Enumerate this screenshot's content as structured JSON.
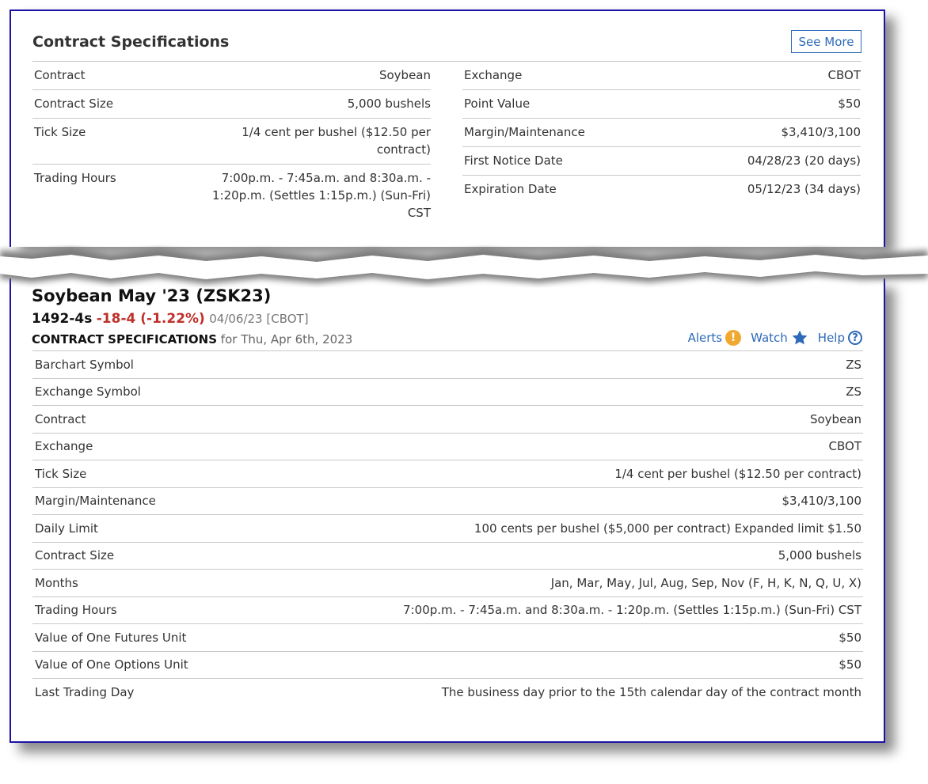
{
  "top": {
    "title": "Contract Specifications",
    "see_more_label": "See More",
    "left_rows": [
      {
        "label": "Contract",
        "value": "Soybean"
      },
      {
        "label": "Contract Size",
        "value": "5,000 bushels"
      },
      {
        "label": "Tick Size",
        "value": "1/4 cent per bushel ($12.50 per contract)"
      },
      {
        "label": "Trading Hours",
        "value": "7:00p.m. - 7:45a.m. and 8:30a.m. - 1:20p.m. (Settles 1:15p.m.) (Sun-Fri) CST"
      }
    ],
    "right_rows": [
      {
        "label": "Exchange",
        "value": "CBOT"
      },
      {
        "label": "Point Value",
        "value": "$50"
      },
      {
        "label": "Margin/Maintenance",
        "value": "$3,410/3,100"
      },
      {
        "label": "First Notice Date",
        "value": "04/28/23 (20 days)"
      },
      {
        "label": "Expiration Date",
        "value": "05/12/23 (34 days)"
      }
    ]
  },
  "quote": {
    "title": "Soybean May '23 (ZSK23)",
    "price": "1492-4s",
    "change": "-18-4 (-1.22%)",
    "date_exchange": "04/06/23 [CBOT]",
    "section_label": "CONTRACT SPECIFICATIONS",
    "section_date": "for Thu, Apr 6th, 2023",
    "alerts_label": "Alerts",
    "watch_label": "Watch",
    "help_label": "Help"
  },
  "contract_table": [
    {
      "label": "Barchart Symbol",
      "value": "ZS"
    },
    {
      "label": "Exchange Symbol",
      "value": "ZS"
    },
    {
      "label": "Contract",
      "value": "Soybean"
    },
    {
      "label": "Exchange",
      "value": "CBOT"
    },
    {
      "label": "Tick Size",
      "value": "1/4 cent per bushel ($12.50 per contract)"
    },
    {
      "label": "Margin/Maintenance",
      "value": "$3,410/3,100"
    },
    {
      "label": "Daily Limit",
      "value": "100 cents per bushel ($5,000 per contract) Expanded limit $1.50"
    },
    {
      "label": "Contract Size",
      "value": "5,000 bushels"
    },
    {
      "label": "Months",
      "value": "Jan, Mar, May, Jul, Aug, Sep, Nov (F, H, K, N, Q, U, X)"
    },
    {
      "label": "Trading Hours",
      "value": "7:00p.m. - 7:45a.m. and 8:30a.m. - 1:20p.m. (Settles 1:15p.m.) (Sun-Fri) CST"
    },
    {
      "label": "Value of One Futures Unit",
      "value": "$50"
    },
    {
      "label": "Value of One Options Unit",
      "value": "$50"
    },
    {
      "label": "Last Trading Day",
      "value": "The business day prior to the 15th calendar day of the contract month"
    }
  ],
  "colors": {
    "frame": "#1c12a8",
    "link": "#2d6ab8",
    "negative": "#c0302a",
    "alert": "#f0a830"
  },
  "icons": {
    "alert": "alert-exclamation-icon",
    "watch": "star-icon",
    "help": "question-circle-icon"
  }
}
